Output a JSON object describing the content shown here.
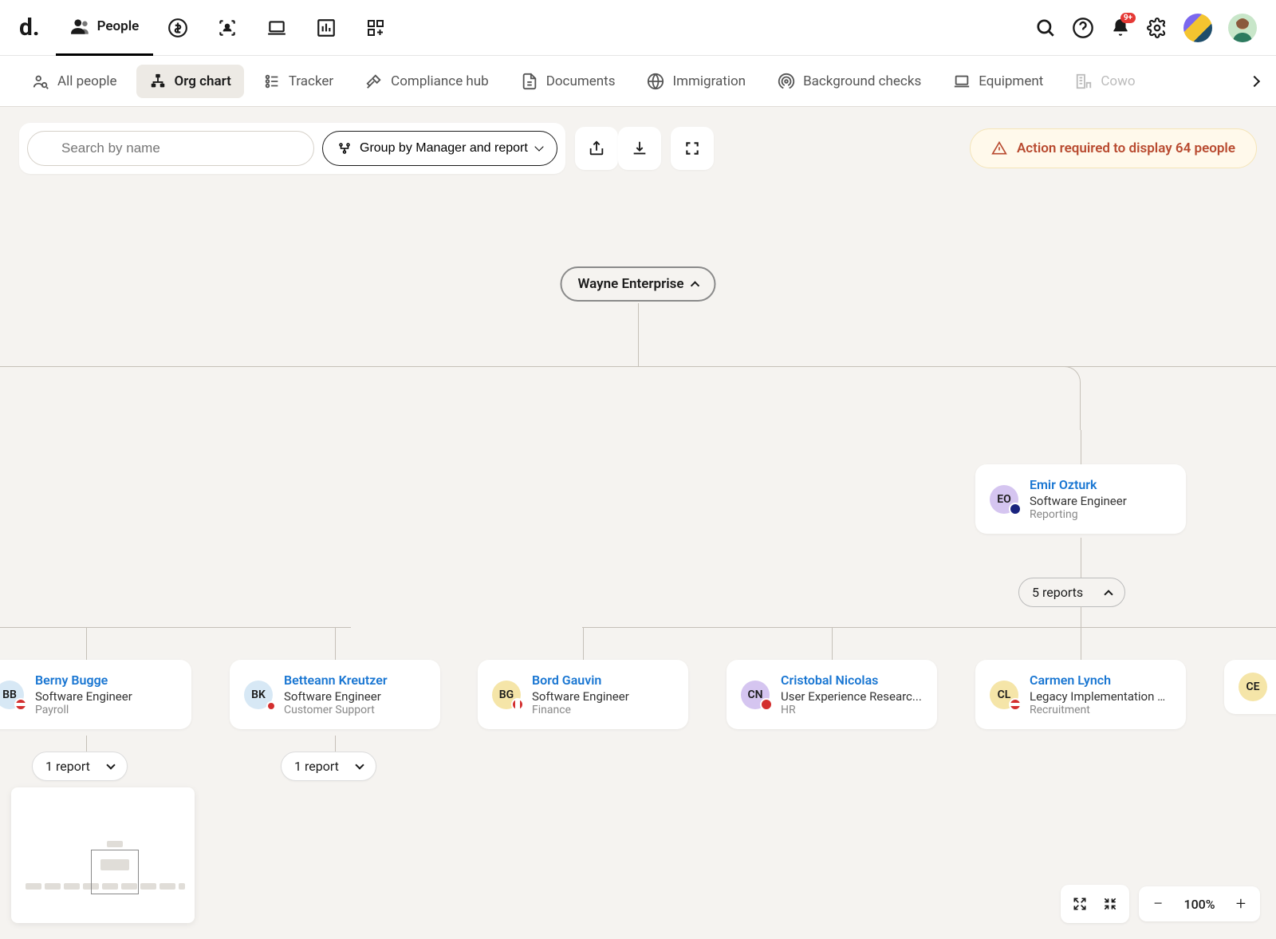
{
  "topnav": {
    "logo": "d.",
    "active_tab": "People",
    "notif_badge": "9+"
  },
  "subnav": {
    "items": [
      {
        "label": "All people"
      },
      {
        "label": "Org chart"
      },
      {
        "label": "Tracker"
      },
      {
        "label": "Compliance hub"
      },
      {
        "label": "Documents"
      },
      {
        "label": "Immigration"
      },
      {
        "label": "Background checks"
      },
      {
        "label": "Equipment"
      },
      {
        "label": "Cowo"
      }
    ]
  },
  "toolbar": {
    "search_placeholder": "Search by name",
    "group_label": "Group by Manager and report",
    "alert_text": "Action required to display 64 people"
  },
  "org": {
    "root": "Wayne Enterprise",
    "emir": {
      "initials": "EO",
      "name": "Emir Ozturk",
      "role": "Software Engineer",
      "dept": "Reporting",
      "reports_label": "5 reports"
    },
    "people": [
      {
        "initials": "BB",
        "name": "Berny Bugge",
        "role": "Software Engineer",
        "dept": "Payroll",
        "avatar_bg": "#d7e8f5",
        "reports": "1 report"
      },
      {
        "initials": "BK",
        "name": "Betteann Kreutzer",
        "role": "Software Engineer",
        "dept": "Customer Support",
        "avatar_bg": "#d7e8f5",
        "reports": "1 report"
      },
      {
        "initials": "BG",
        "name": "Bord Gauvin",
        "role": "Software Engineer",
        "dept": "Finance",
        "avatar_bg": "#f5e5a8"
      },
      {
        "initials": "CN",
        "name": "Cristobal Nicolas",
        "role": "User Experience Researc...",
        "dept": "HR",
        "avatar_bg": "#d5c5f0"
      },
      {
        "initials": "CL",
        "name": "Carmen Lynch",
        "role": "Legacy Implementation A...",
        "dept": "Recruitment",
        "avatar_bg": "#f5e5a8"
      },
      {
        "initials": "CE",
        "name": "",
        "role": "",
        "dept": "",
        "avatar_bg": "#f5e5a8"
      }
    ]
  },
  "zoom": {
    "level": "100%"
  }
}
